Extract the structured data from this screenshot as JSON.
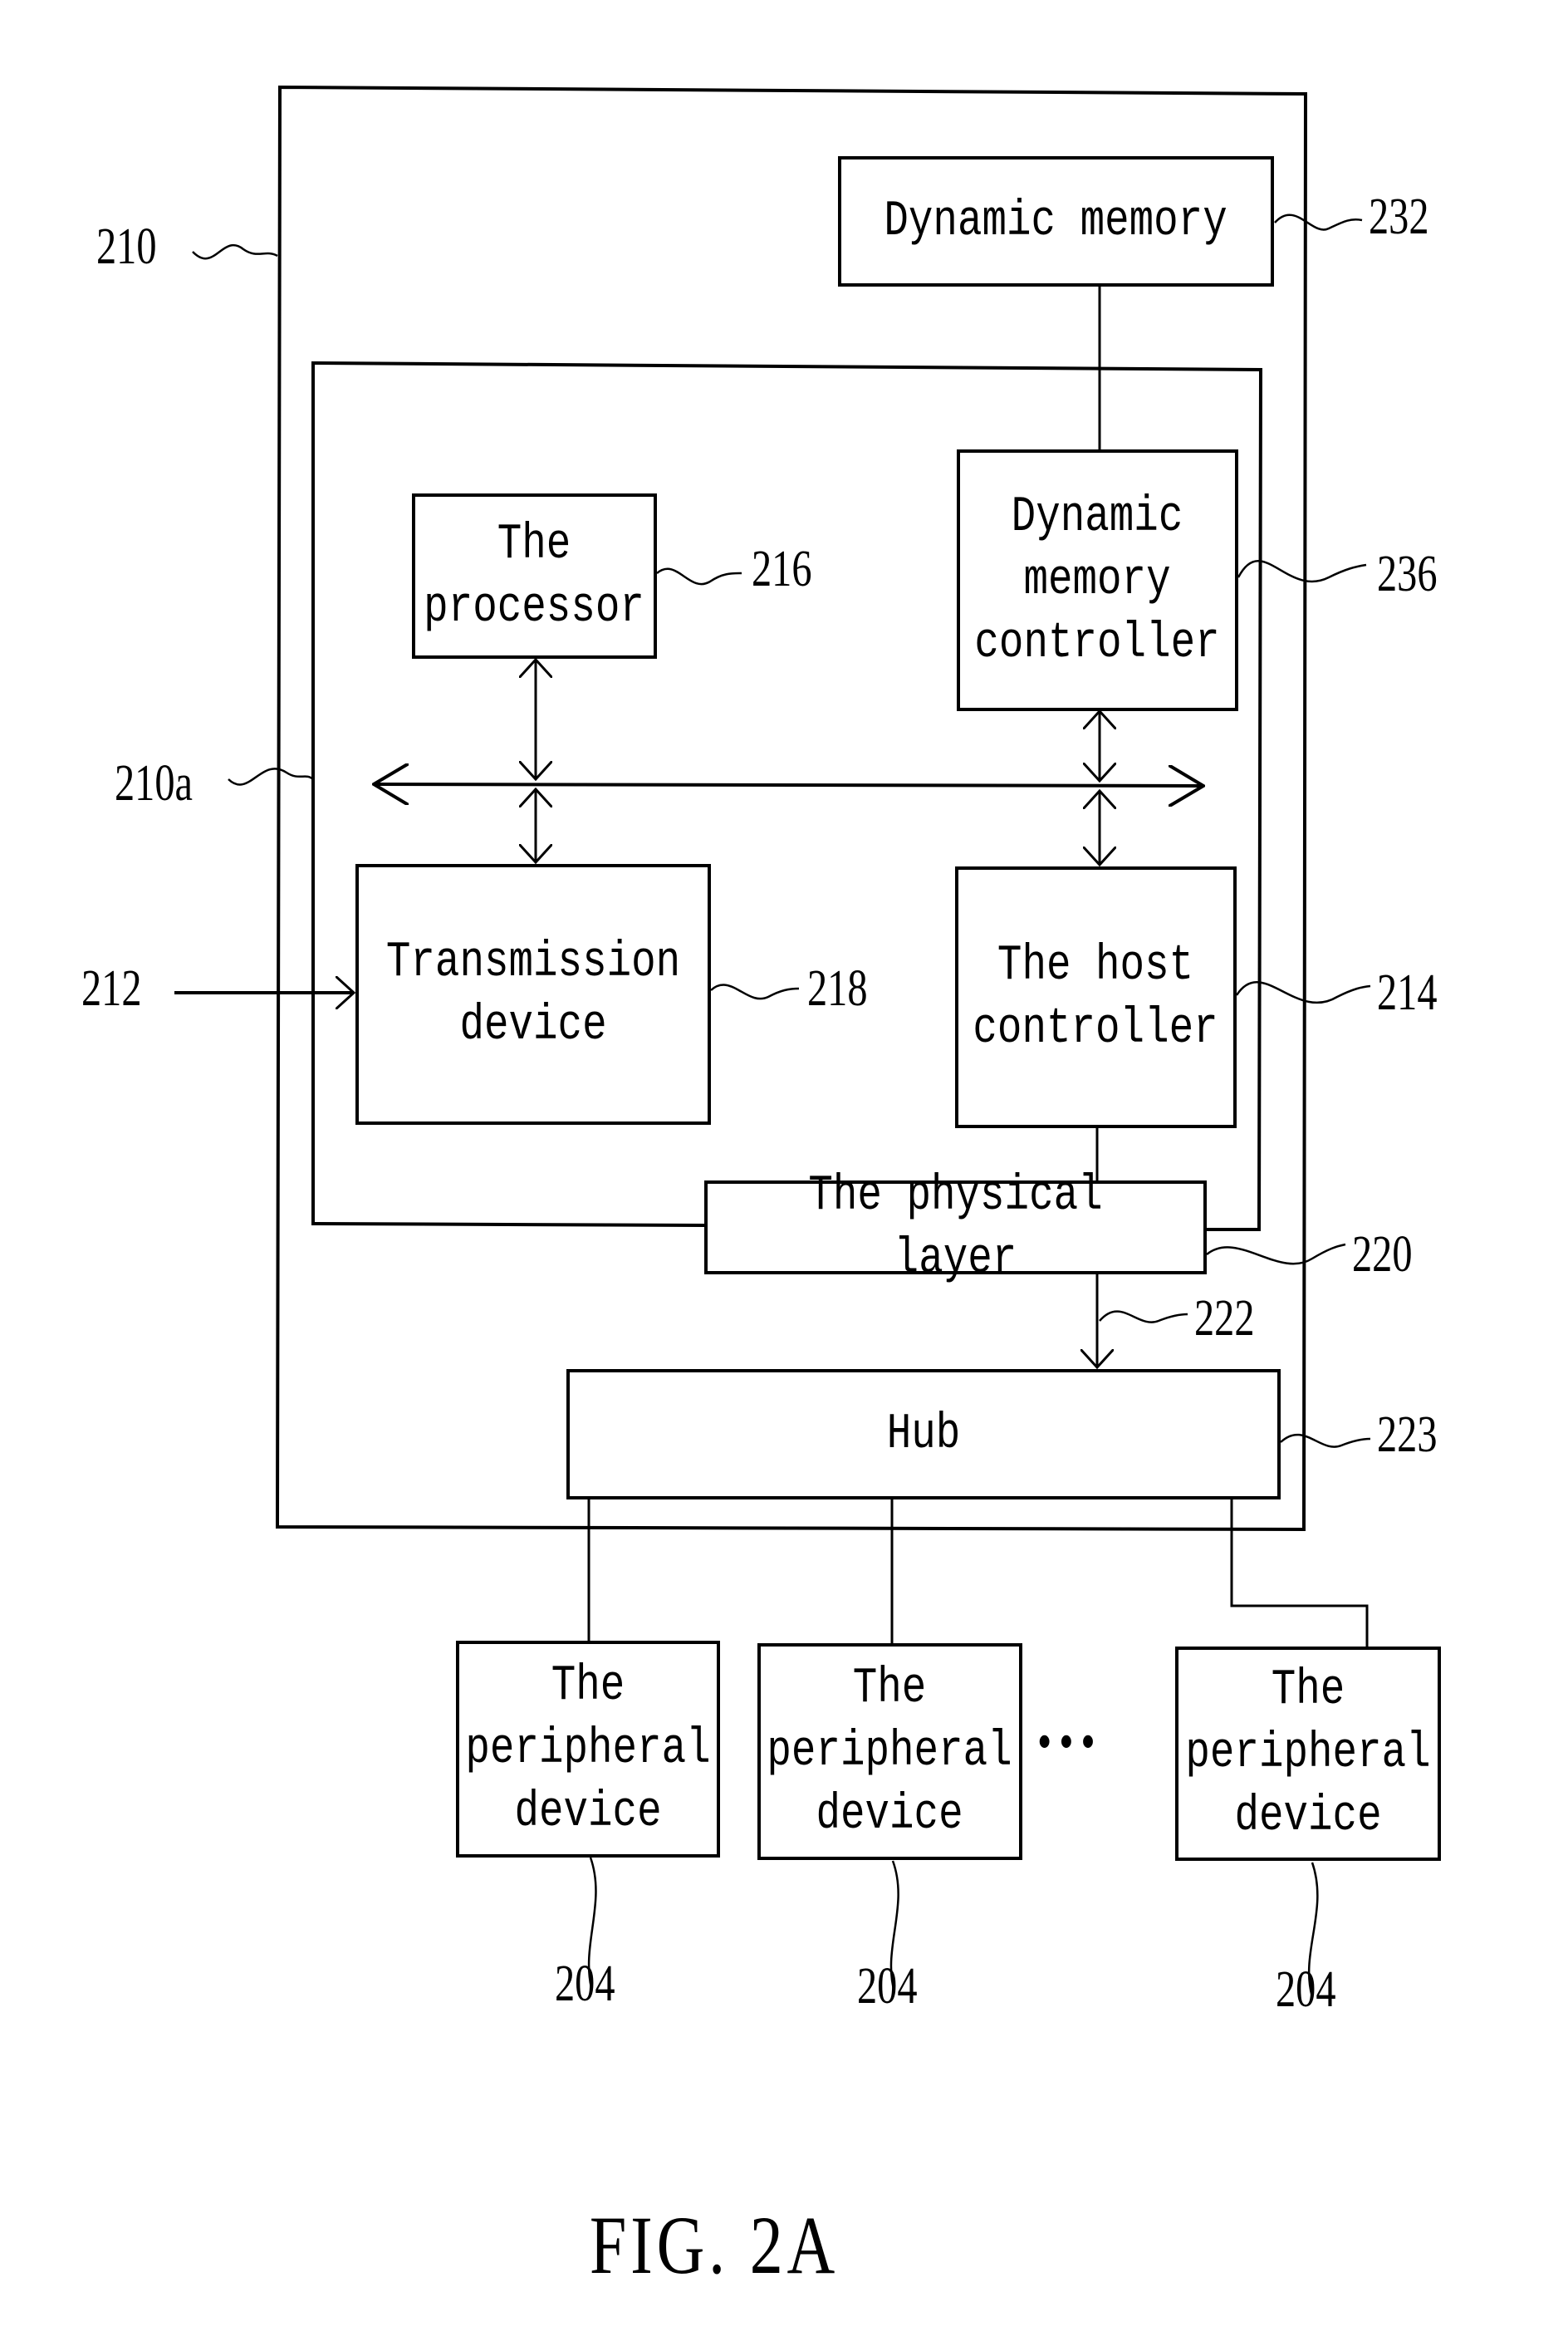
{
  "figure": {
    "caption": "FIG. 2A",
    "blocks": {
      "dynamic_memory": "Dynamic memory",
      "processor": "The\nprocessor",
      "dynamic_memory_controller": "Dynamic\nmemory\ncontroller",
      "transmission_device": "Transmission\ndevice",
      "host_controller": "The host\ncontroller",
      "physical_layer": "The physical layer",
      "hub": "Hub",
      "peripheral_1": "The\nperipheral\ndevice",
      "peripheral_2": "The\nperipheral\ndevice",
      "peripheral_3": "The\nperipheral\ndevice"
    },
    "ellipsis": "• • •",
    "refs": {
      "r210": "210",
      "r210a": "210a",
      "r212": "212",
      "r214": "214",
      "r216": "216",
      "r218": "218",
      "r220": "220",
      "r222": "222",
      "r223": "223",
      "r232": "232",
      "r236": "236",
      "r204a": "204",
      "r204b": "204",
      "r204c": "204"
    }
  }
}
